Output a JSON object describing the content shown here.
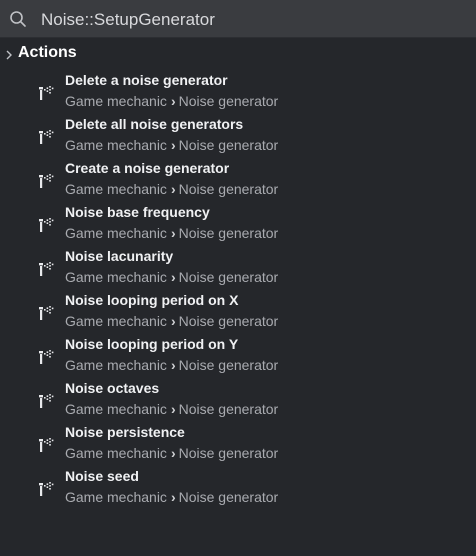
{
  "search": {
    "value": "Noise::SetupGenerator",
    "icon": "search-icon"
  },
  "section": {
    "title": "Actions",
    "icon": "chevron-right-icon"
  },
  "items": [
    {
      "title": "Delete a noise generator",
      "category": "Game mechanic",
      "subcategory": "Noise generator"
    },
    {
      "title": "Delete all noise generators",
      "category": "Game mechanic",
      "subcategory": "Noise generator"
    },
    {
      "title": "Create a noise generator",
      "category": "Game mechanic",
      "subcategory": "Noise generator"
    },
    {
      "title": "Noise base frequency",
      "category": "Game mechanic",
      "subcategory": "Noise generator"
    },
    {
      "title": "Noise lacunarity",
      "category": "Game mechanic",
      "subcategory": "Noise generator"
    },
    {
      "title": "Noise looping period on X",
      "category": "Game mechanic",
      "subcategory": "Noise generator"
    },
    {
      "title": "Noise looping period on Y",
      "category": "Game mechanic",
      "subcategory": "Noise generator"
    },
    {
      "title": "Noise octaves",
      "category": "Game mechanic",
      "subcategory": "Noise generator"
    },
    {
      "title": "Noise persistence",
      "category": "Game mechanic",
      "subcategory": "Noise generator"
    },
    {
      "title": "Noise seed",
      "category": "Game mechanic",
      "subcategory": "Noise generator"
    }
  ],
  "path_separator": "›",
  "item_icon": "noise-generator-icon",
  "colors": {
    "background": "#25272b",
    "search_bar": "#3a3c40",
    "title_text": "#f0f1f3",
    "path_text": "#a9abb0"
  }
}
